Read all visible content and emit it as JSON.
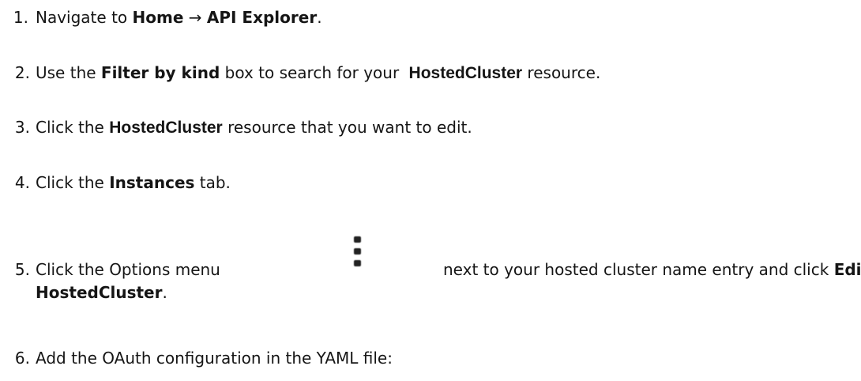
{
  "steps": [
    {
      "number": "1.",
      "parts": [
        "Navigate to ",
        "Home",
        " → ",
        "API Explorer",
        "."
      ]
    },
    {
      "number": "2.",
      "parts": [
        "Use the ",
        "Filter by kind",
        " box to search for your ",
        "HostedCluster",
        " resource."
      ]
    },
    {
      "number": "3.",
      "parts": [
        "Click the ",
        "HostedCluster",
        " resource that you want to edit."
      ]
    },
    {
      "number": "4.",
      "parts": [
        "Click the ",
        "Instances",
        " tab."
      ]
    },
    {
      "number": "5.",
      "parts": [
        "Click the Options menu",
        "next to your hosted cluster name entry and click ",
        "Edit",
        "HostedCluster",
        "."
      ],
      "icon": "kebab-menu-icon"
    },
    {
      "number": "6.",
      "parts": [
        "Add the OAuth configuration in the YAML file:"
      ]
    }
  ]
}
